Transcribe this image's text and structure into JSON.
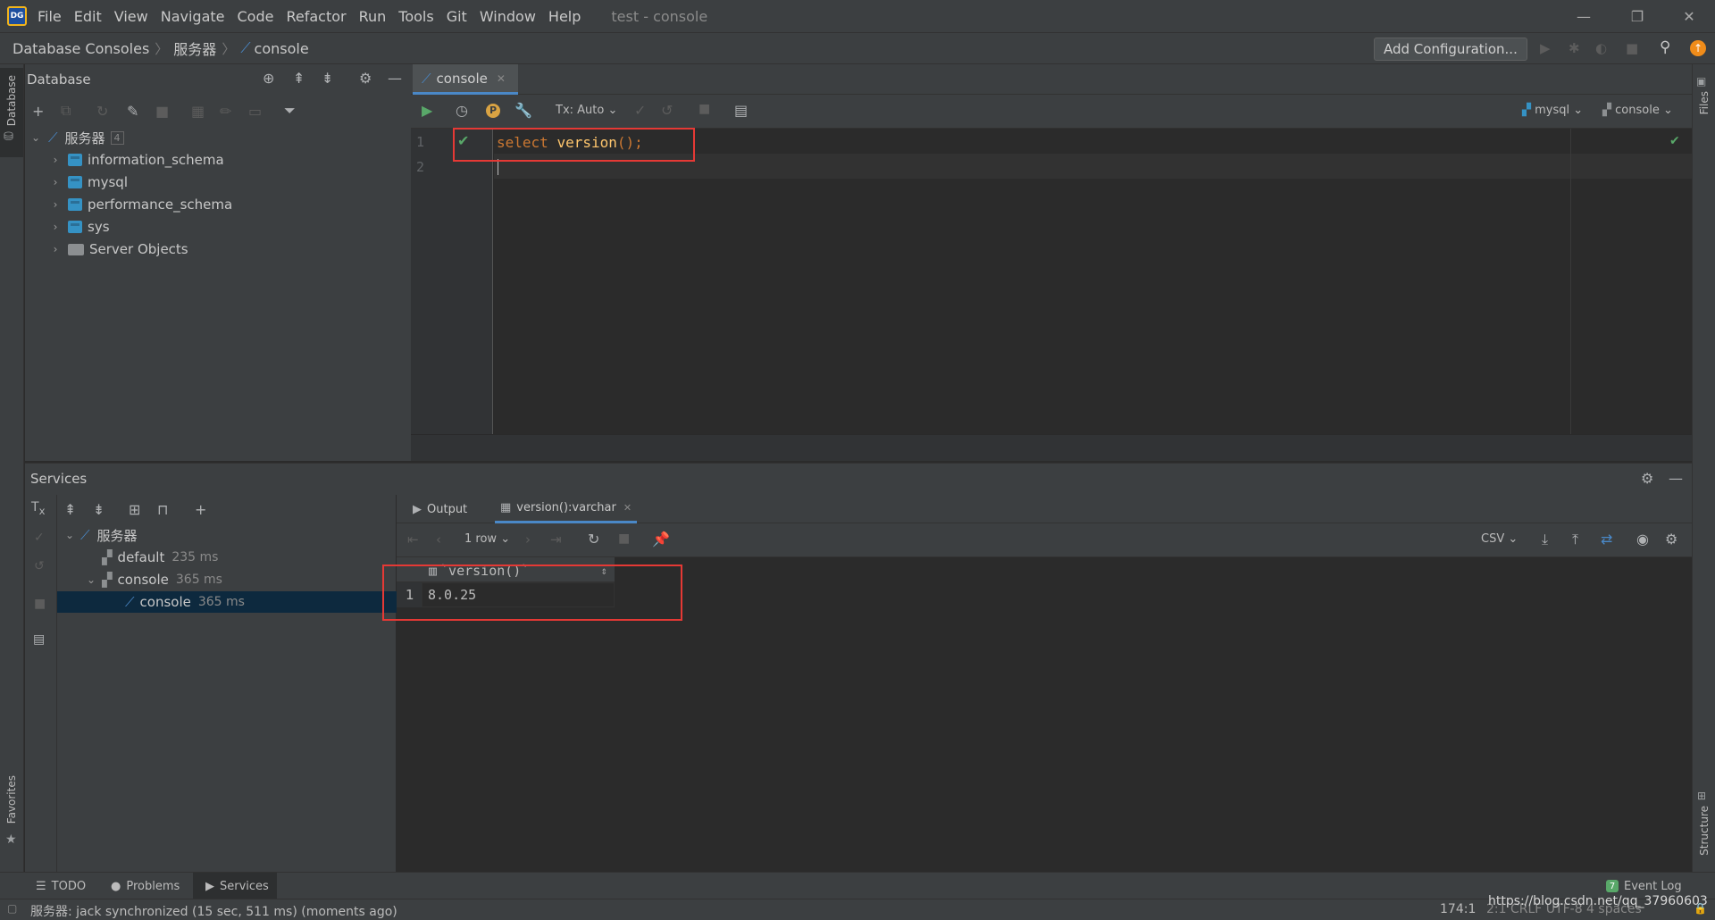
{
  "titlebar": {
    "menu": [
      "File",
      "Edit",
      "View",
      "Navigate",
      "Code",
      "Refactor",
      "Run",
      "Tools",
      "Git",
      "Window",
      "Help"
    ],
    "window_title": "test - console"
  },
  "navbar": {
    "breadcrumbs": [
      "Database Consoles",
      "服务器",
      "console"
    ],
    "add_configuration": "Add Configuration..."
  },
  "left_strip": {
    "database_label": "Database",
    "favorites_label": "Favorites"
  },
  "right_strip": {
    "files_label": "Files",
    "structure_label": "Structure"
  },
  "database_panel": {
    "title": "Database",
    "root": {
      "label": "服务器",
      "count": "4"
    },
    "children": [
      {
        "label": "information_schema"
      },
      {
        "label": "mysql"
      },
      {
        "label": "performance_schema"
      },
      {
        "label": "sys"
      },
      {
        "label": "Server Objects"
      }
    ]
  },
  "editor": {
    "tab_label": "console",
    "tx_mode": "Tx: Auto",
    "datasource": "mysql",
    "session": "console",
    "lines": [
      "1",
      "2"
    ],
    "code": {
      "keyword": "select",
      "function": "version",
      "rest": "();"
    }
  },
  "services": {
    "title": "Services",
    "tree": [
      {
        "label": "服务器",
        "time": ""
      },
      {
        "label": "default",
        "time": "235 ms"
      },
      {
        "label": "console",
        "time": "365 ms"
      },
      {
        "label": "console",
        "time": "365 ms"
      }
    ]
  },
  "results": {
    "tabs": [
      "Output",
      "version():varchar"
    ],
    "row_count": "1 row",
    "export_format": "CSV",
    "column_header": "`version()`",
    "rows": [
      {
        "num": "1",
        "value": "8.0.25"
      }
    ]
  },
  "bottom_tabs": [
    "TODO",
    "Problems",
    "Services"
  ],
  "event_log": {
    "label": "Event Log",
    "count": "7"
  },
  "statusbar": {
    "message": "服务器: jack synchronized (15 sec, 511 ms) (moments ago)",
    "position": "174:1",
    "line_sep": "2:1  CRLF  UTF-8  4 spaces",
    "watermark": "https://blog.csdn.net/qq_37960603"
  },
  "colors": {
    "accent": "#4a88c7",
    "highlight_box": "#e53935",
    "keyword": "#cc7832",
    "function": "#ffc66d"
  }
}
